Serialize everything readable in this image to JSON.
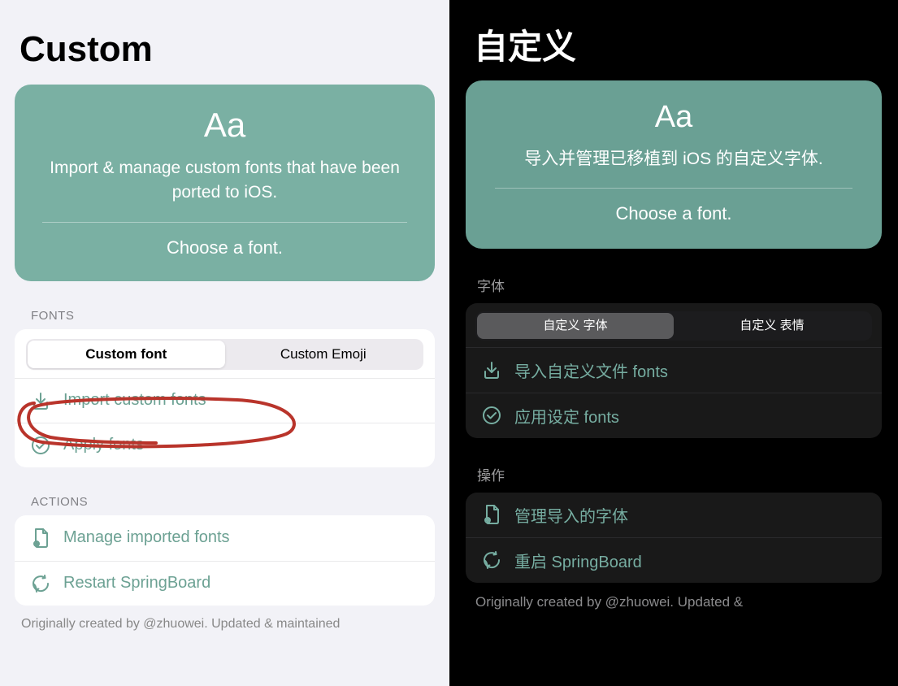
{
  "left": {
    "title": "Custom",
    "hero": {
      "aa": "Aa",
      "description": "Import & manage custom fonts that have been ported to iOS.",
      "choose": "Choose a font."
    },
    "fonts": {
      "header": "FONTS",
      "segments": [
        {
          "label": "Custom font",
          "active": true
        },
        {
          "label": "Custom Emoji",
          "active": false
        }
      ],
      "rows": {
        "import": "Import custom fonts",
        "apply": "Apply fonts"
      }
    },
    "actions": {
      "header": "ACTIONS",
      "rows": {
        "manage": "Manage imported fonts",
        "restart": "Restart SpringBoard"
      }
    },
    "footer": "Originally created by @zhuowei. Updated & maintained"
  },
  "right": {
    "title": "自定义",
    "hero": {
      "aa": "Aa",
      "description": "导入并管理已移植到 iOS 的自定义字体.",
      "choose": "Choose a font."
    },
    "fonts": {
      "header": "字体",
      "segments": [
        {
          "label": "自定义 字体",
          "active": true
        },
        {
          "label": "自定义 表情",
          "active": false
        }
      ],
      "rows": {
        "import": "导入自定义文件 fonts",
        "apply": "应用设定 fonts"
      }
    },
    "actions": {
      "header": "操作",
      "rows": {
        "manage": "管理导入的字体",
        "restart": "重启 SpringBoard"
      }
    },
    "footer": "Originally created by @zhuowei. Updated &"
  },
  "colors": {
    "accent_light": "#6ca193",
    "accent_dark": "#76ada1",
    "hero_bg_light": "#7ab0a3",
    "hero_bg_dark": "#6aa094"
  }
}
